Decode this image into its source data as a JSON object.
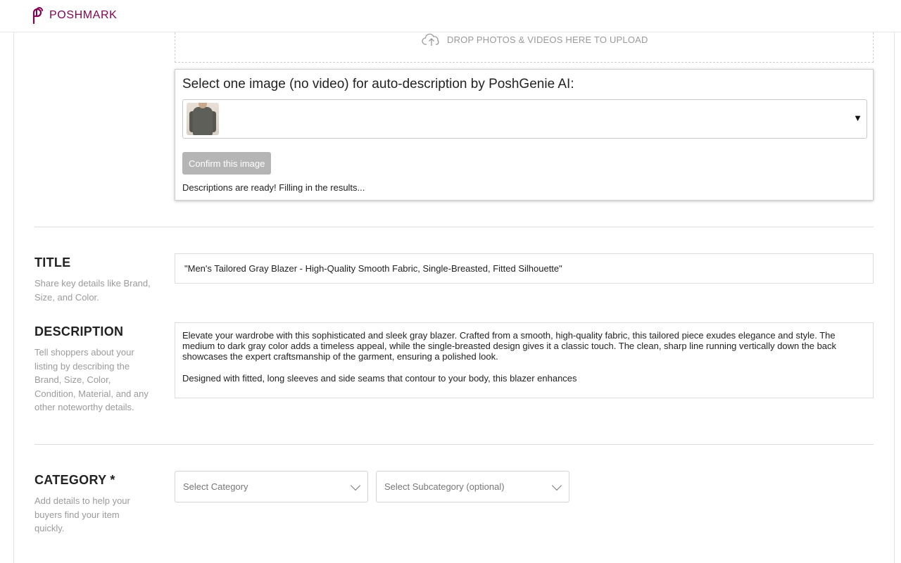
{
  "header": {
    "brand": "POSHMARK",
    "logo_icon": "poshmark-logo-icon",
    "brand_color": "#7f0353"
  },
  "upload": {
    "drop_text": "DROP PHOTOS & VIDEOS HERE TO UPLOAD",
    "icon": "cloud-upload-icon"
  },
  "genie": {
    "title": "Select one image (no video) for auto-description by PoshGenie AI:",
    "selected_image_alt": "gray blazer thumbnail",
    "dropdown_caret": "▼",
    "confirm_label": "Confirm this image",
    "status": "Descriptions are ready! Filling in the results..."
  },
  "title_section": {
    "heading": "TITLE",
    "help": "Share key details like Brand, Size, and Color.",
    "value": "\"Men's Tailored Gray Blazer - High-Quality Smooth Fabric, Single-Breasted, Fitted Silhouette\""
  },
  "description_section": {
    "heading": "DESCRIPTION",
    "help": "Tell shoppers about your listing by describing the Brand, Size, Color, Condition, Material, and any other noteworthy details.",
    "paragraph_1": "Elevate your wardrobe with this sophisticated and sleek gray blazer. Crafted from a smooth, high-quality fabric, this tailored piece exudes elegance and style. The medium to dark gray color adds a timeless appeal, while the single-breasted design gives it a classic touch. The clean, sharp line running vertically down the back showcases the expert craftsmanship of the garment, ensuring a polished look.",
    "paragraph_2": "Designed with fitted, long sleeves and side seams that contour to your body, this blazer enhances"
  },
  "category_section": {
    "heading": "CATEGORY *",
    "help": "Add details to help your buyers find your item quickly.",
    "category_placeholder": "Select Category",
    "subcategory_placeholder": "Select Subcategory (optional)"
  }
}
